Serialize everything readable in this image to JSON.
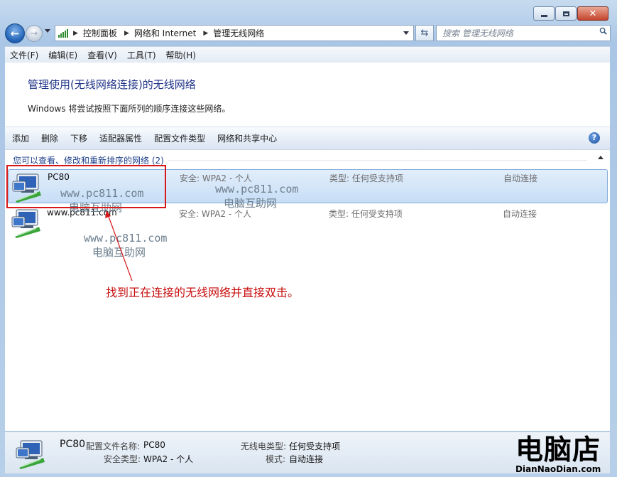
{
  "window": {
    "controls": [
      "minimize",
      "maximize",
      "close"
    ]
  },
  "nav": {
    "breadcrumb": [
      "控制面板",
      "网络和 Internet",
      "管理无线网络"
    ],
    "search_placeholder": "搜索 管理无线网络"
  },
  "menu": [
    "文件(F)",
    "编辑(E)",
    "查看(V)",
    "工具(T)",
    "帮助(H)"
  ],
  "page": {
    "title": "管理使用(无线网络连接)的无线网络",
    "description": "Windows 将尝试按照下面所列的顺序连接这些网络。"
  },
  "commands": [
    "添加",
    "删除",
    "下移",
    "适配器属性",
    "配置文件类型",
    "网络和共享中心"
  ],
  "group_header": "您可以查看、修改和重新排序的网络 (2)",
  "networks": [
    {
      "name": "PC80",
      "security": "安全: WPA2 - 个人",
      "type": "类型: 任何受支持项",
      "mode": "自动连接",
      "selected": true
    },
    {
      "name": "www.pc811.com",
      "security": "安全: WPA2 - 个人",
      "type": "类型: 任何受支持项",
      "mode": "自动连接",
      "selected": false
    }
  ],
  "watermarks": [
    {
      "url": "www.pc811.com",
      "text": "电脑互助网"
    },
    {
      "url": "www.pc811.com",
      "text": "电脑互助网"
    },
    {
      "url": "www.pc811.com",
      "text": "电脑互助网"
    }
  ],
  "annotation": "找到正在连接的无线网络并直接双击。",
  "details": {
    "name": "PC80",
    "profile_label": "配置文件名称:",
    "profile_value": "PC80",
    "radio_label": "无线电类型:",
    "radio_value": "任何受支持项",
    "security_label": "安全类型:",
    "security_value": "WPA2 - 个人",
    "mode_label": "模式:",
    "mode_value": "自动连接"
  },
  "brand": {
    "logo": "电脑店",
    "url": "DianNaoDian.com"
  },
  "colors": {
    "annotation_red": "#d81818",
    "title_blue": "#1e3287",
    "selection": "#c7def6"
  }
}
